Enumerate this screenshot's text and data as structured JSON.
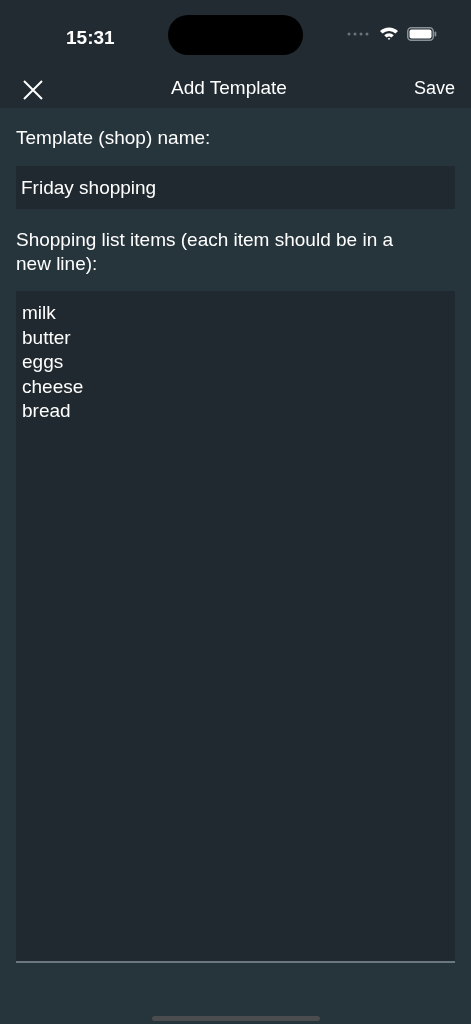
{
  "status_bar": {
    "time": "15:31"
  },
  "nav": {
    "title": "Add Template",
    "save": "Save"
  },
  "name_field": {
    "label": "Template (shop) name:",
    "value": "Friday shopping"
  },
  "items_field": {
    "label": "Shopping list items (each item should be in a new line):",
    "lines": [
      "milk",
      "butter",
      "eggs",
      "cheese",
      "bread"
    ]
  }
}
